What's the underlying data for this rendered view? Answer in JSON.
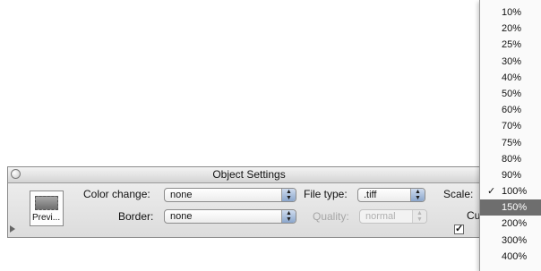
{
  "palette": {
    "title": "Object Settings",
    "preview_label": "Previ...",
    "color_change_label": "Color change:",
    "color_change_value": "none",
    "border_label": "Border:",
    "border_value": "none",
    "file_type_label": "File type:",
    "file_type_value": ".tiff",
    "quality_label": "Quality:",
    "quality_value": "normal",
    "scale_label": "Scale:",
    "checkbox_label": "Cu",
    "checkbox_checked": true,
    "checkmark_glyph": "✓"
  },
  "icons": {
    "close": "close-circle-icon",
    "preview": "preview-swatch-icon",
    "disclosure": "disclosure-triangle-icon",
    "popup_arrows": "up-down-arrows-icon",
    "checkmark": "checkmark-icon"
  },
  "scale_menu": {
    "items": [
      "10%",
      "20%",
      "25%",
      "30%",
      "40%",
      "50%",
      "60%",
      "70%",
      "75%",
      "80%",
      "90%",
      "100%",
      "150%",
      "200%",
      "300%",
      "400%"
    ],
    "checked": "100%",
    "highlighted": "150%",
    "checkmark_glyph": "✓"
  },
  "colors": {
    "highlight": "#6e6e6e",
    "popup_arrow_accent": "#8ba6cc",
    "palette_background": "#e4e4e4"
  }
}
